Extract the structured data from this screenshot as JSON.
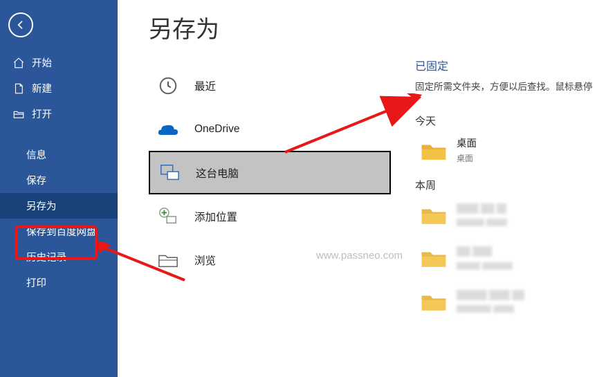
{
  "page_title": "另存为",
  "sidebar": {
    "items": [
      {
        "label": "开始",
        "icon": "home"
      },
      {
        "label": "新建",
        "icon": "new-file"
      },
      {
        "label": "打开",
        "icon": "open-folder"
      }
    ],
    "items2": [
      {
        "label": "信息"
      },
      {
        "label": "保存"
      },
      {
        "label": "另存为"
      },
      {
        "label": "保存到百度网盘"
      },
      {
        "label": "历史记录"
      },
      {
        "label": "打印"
      }
    ]
  },
  "locations": [
    {
      "label": "最近",
      "icon": "recent"
    },
    {
      "label": "OneDrive",
      "icon": "onedrive"
    },
    {
      "label": "这台电脑",
      "icon": "this-pc"
    },
    {
      "label": "添加位置",
      "icon": "add-place"
    },
    {
      "label": "浏览",
      "icon": "browse"
    }
  ],
  "pinned": {
    "title": "已固定",
    "hint": "固定所需文件夹，方便以后查找。鼠标悬停"
  },
  "groups": [
    {
      "title": "今天",
      "items": [
        {
          "name": "桌面",
          "path": "桌面"
        }
      ]
    },
    {
      "title": "本周",
      "items": [
        {
          "name": "",
          "path": ""
        },
        {
          "name": "",
          "path": ""
        },
        {
          "name": "",
          "path": ""
        }
      ]
    }
  ],
  "watermark": "www.passneo.com"
}
